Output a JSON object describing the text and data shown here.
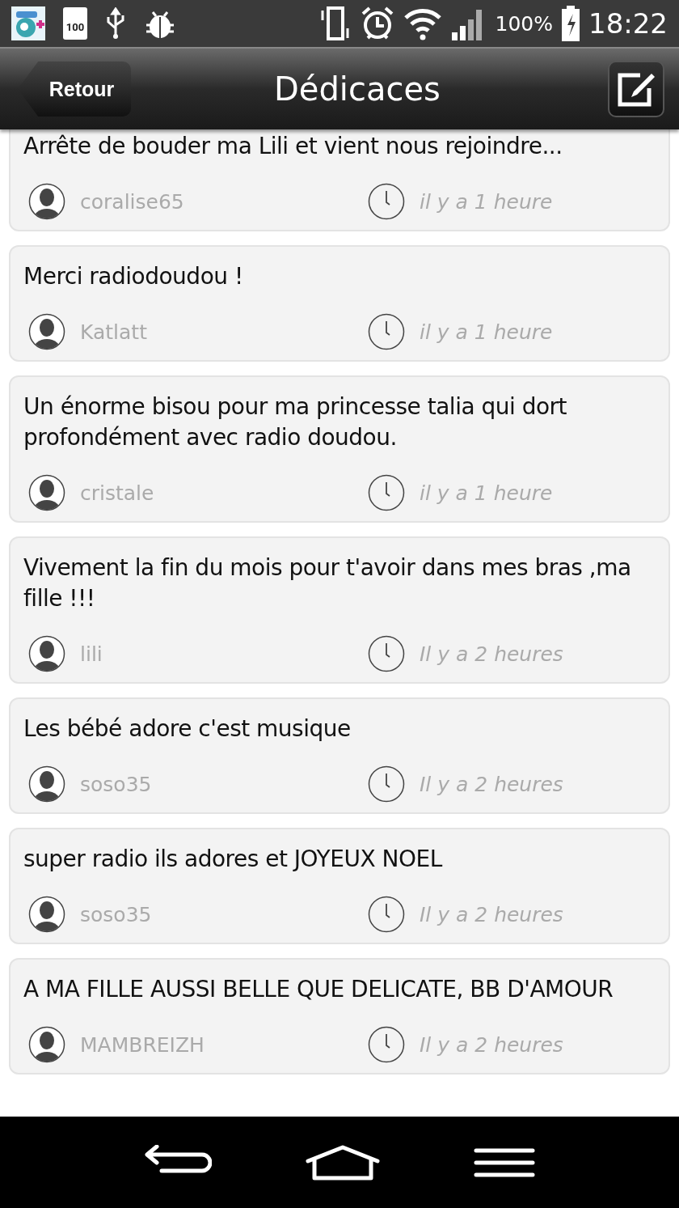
{
  "status_bar": {
    "battery_notification": "100",
    "battery_percent": "100%",
    "time": "18:22"
  },
  "header": {
    "back_button": "Retour",
    "title": "Dédicaces"
  },
  "dedications": [
    {
      "message": "Arrête de bouder ma Lili et vient nous rejoindre...",
      "author": "coralise65",
      "time": "il y a 1 heure"
    },
    {
      "message": "Merci radiodoudou !",
      "author": "Katlatt",
      "time": "il y a 1 heure"
    },
    {
      "message": "Un énorme bisou pour ma princesse talia qui dort profondément avec radio doudou.",
      "author": "cristale",
      "time": "il y a 1 heure"
    },
    {
      "message": "Vivement la fin du mois pour t'avoir dans mes bras ,ma fille !!!",
      "author": "lili",
      "time": "Il y a 2 heures"
    },
    {
      "message": "Les bébé adore c'est musique",
      "author": "soso35",
      "time": "Il y a 2 heures"
    },
    {
      "message": "super radio ils adores et JOYEUX NOEL",
      "author": "soso35",
      "time": "Il y a 2 heures"
    },
    {
      "message": "A MA FILLE AUSSI BELLE QUE DELICATE, BB D'AMOUR",
      "author": "MAMBREIZH",
      "time": "Il y a 2 heures"
    }
  ]
}
